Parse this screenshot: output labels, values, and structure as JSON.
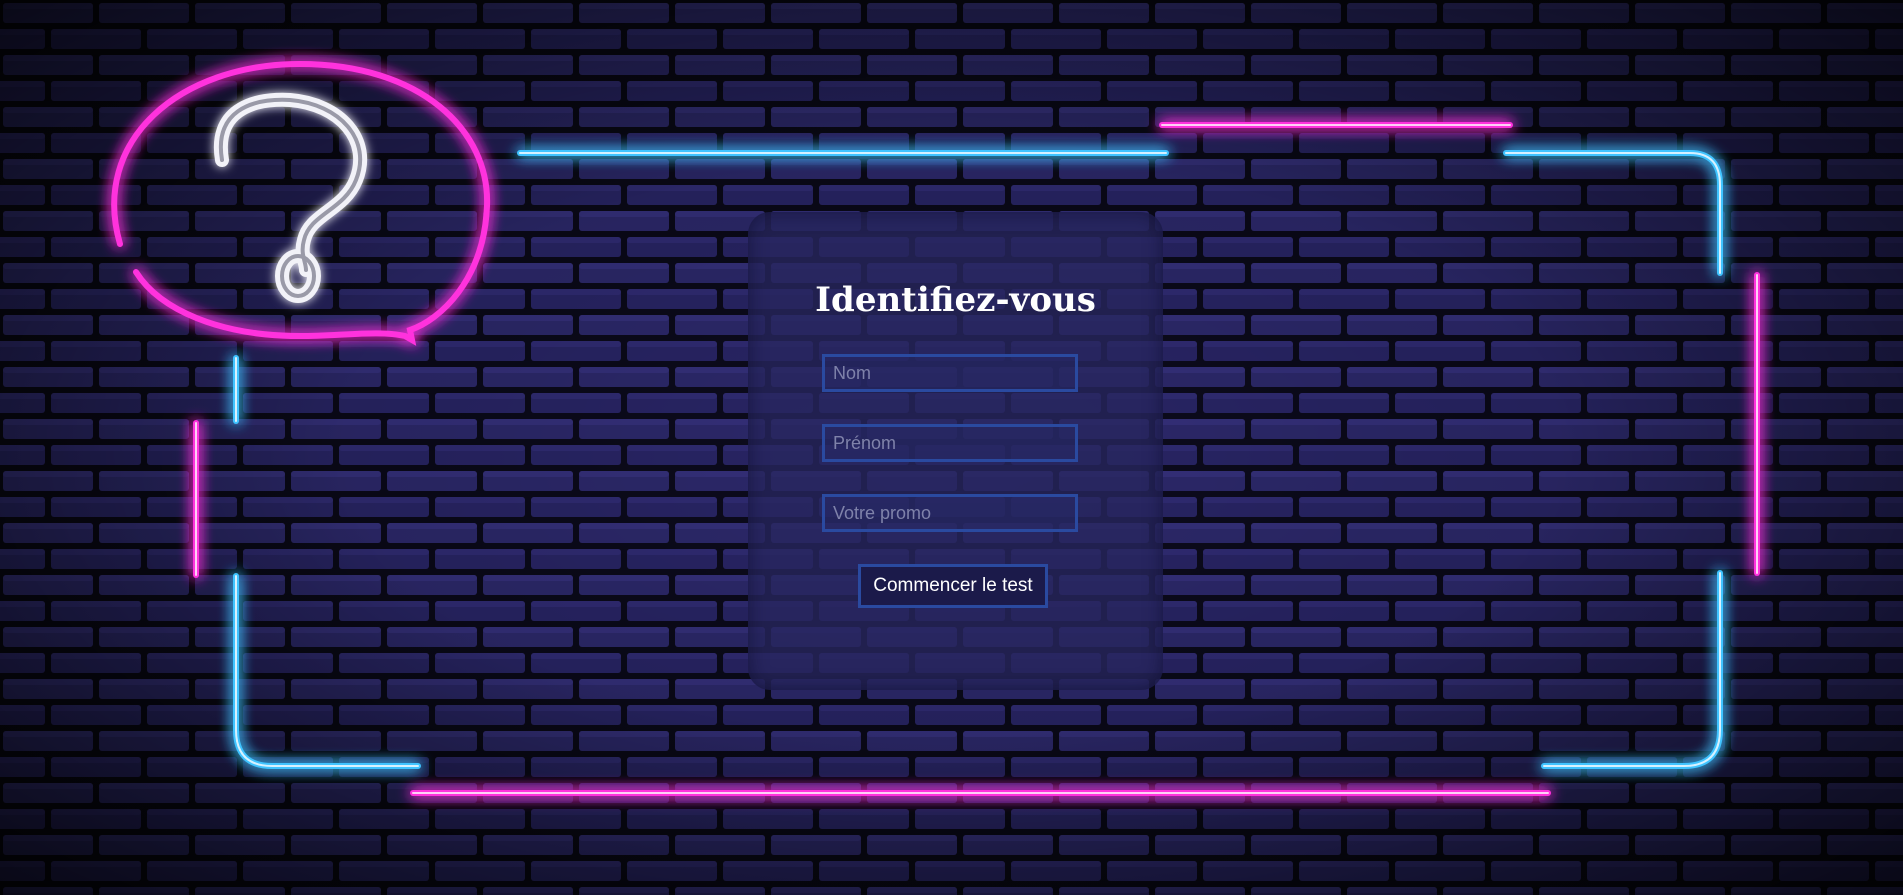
{
  "form": {
    "title": "Identifiez-vous",
    "fields": [
      {
        "placeholder": "Nom",
        "value": ""
      },
      {
        "placeholder": "Prénom",
        "value": ""
      },
      {
        "placeholder": "Votre promo",
        "value": ""
      }
    ],
    "submit_label": "Commencer le test"
  },
  "background": {
    "icon": "question-mark-speech-bubble-icon",
    "colors": {
      "neon_pink": "#ff2bd6",
      "neon_blue": "#2ab8ff",
      "brick": "#2a2760",
      "panel": "#28265f",
      "field_border": "#2a4aa0"
    }
  }
}
